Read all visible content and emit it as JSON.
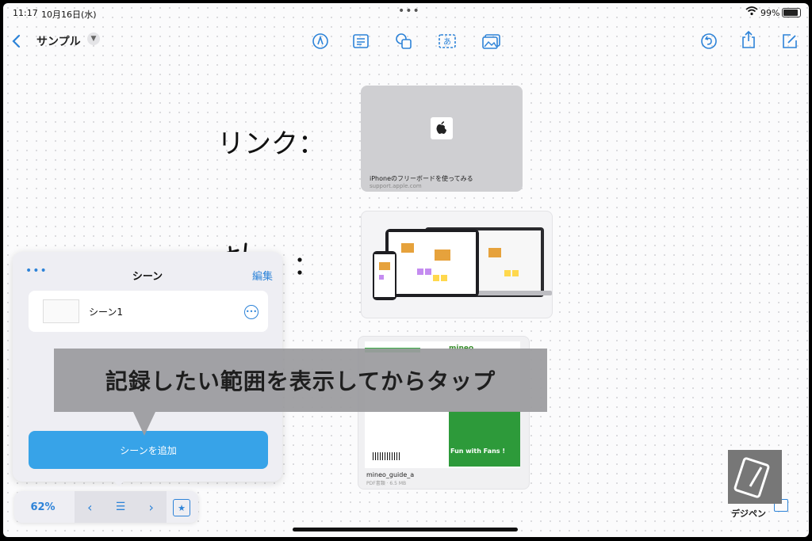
{
  "status_bar": {
    "time": "11:17",
    "date": "10月16日(水)",
    "battery": "99%"
  },
  "toolbar": {
    "back_icon": "chevron-left-icon",
    "title": "サンプル",
    "title_menu_icon": "chevron-down-icon",
    "tools": [
      "pen-icon",
      "textbox-icon",
      "shapes-icon",
      "text-icon",
      "media-icon"
    ],
    "right": [
      "undo-icon",
      "share-icon",
      "compose-icon"
    ]
  },
  "canvas": {
    "handwriting_link": "リンク：",
    "link_card": {
      "title": "iPhoneのフリーボードを使ってみる",
      "url": "support.apple.com"
    },
    "pdf_card": {
      "brand": "mineo",
      "poster_text": "Fun with Fans !",
      "name": "mineo_guide_a",
      "meta": "PDF書類 · 6.5 MB"
    }
  },
  "scenes_panel": {
    "title": "シーン",
    "edit": "編集",
    "scenes": [
      {
        "name": "シーン1"
      }
    ],
    "add_button": "シーンを追加"
  },
  "overlay": {
    "text": "記録したい範囲を表示してからタップ"
  },
  "bottom_bar": {
    "zoom": "62%"
  },
  "logo": {
    "text": "デジペン"
  }
}
